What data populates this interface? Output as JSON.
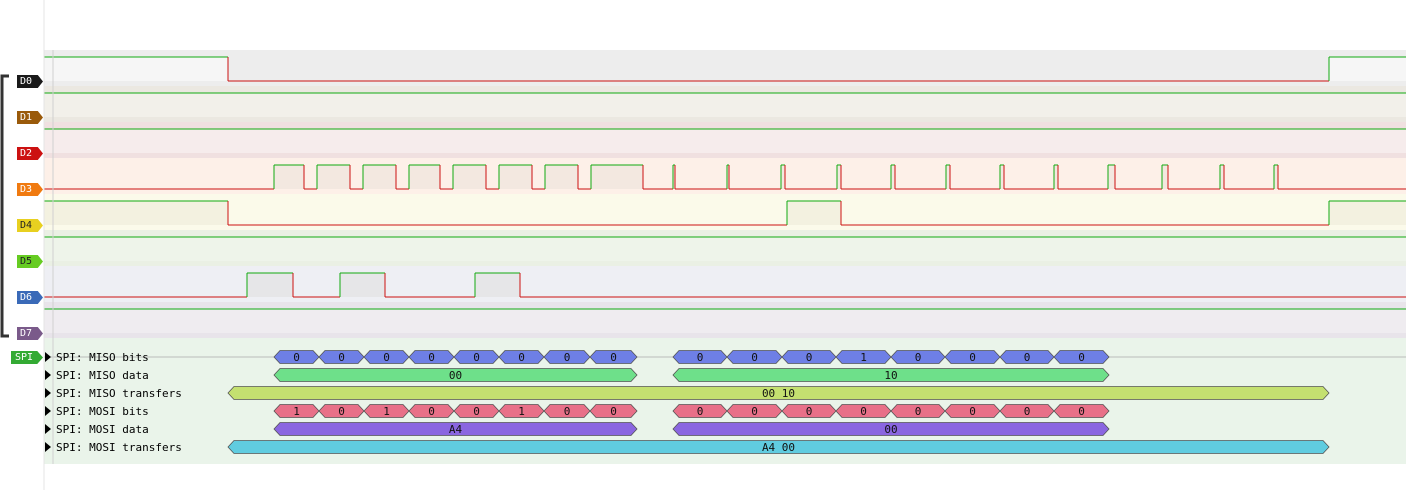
{
  "channels": [
    {
      "name": "D0",
      "color": "#1a1a1a"
    },
    {
      "name": "D1",
      "color": "#9a5a0a"
    },
    {
      "name": "D2",
      "color": "#cc1111"
    },
    {
      "name": "D3",
      "color": "#f07a10"
    },
    {
      "name": "D4",
      "color": "#e8d020"
    },
    {
      "name": "D5",
      "color": "#66cc22"
    },
    {
      "name": "D6",
      "color": "#3a6ab8"
    },
    {
      "name": "D7",
      "color": "#7a5a8a"
    }
  ],
  "decoder": {
    "name": "SPI",
    "color": "#33aa33",
    "rows": [
      {
        "label": "SPI: MISO bits",
        "color": "#6e7fe6",
        "annotations": [
          "0",
          "0",
          "0",
          "0",
          "0",
          "0",
          "0",
          "0",
          "0",
          "0",
          "0",
          "1",
          "0",
          "0",
          "0",
          "0"
        ]
      },
      {
        "label": "SPI: MISO data",
        "color": "#6ee08a",
        "annotations": [
          "00",
          "10"
        ]
      },
      {
        "label": "SPI: MISO transfers",
        "color": "#c4e070",
        "annotations": [
          "00 10"
        ]
      },
      {
        "label": "SPI: MOSI bits",
        "color": "#e87088",
        "annotations": [
          "1",
          "0",
          "1",
          "0",
          "0",
          "1",
          "0",
          "0",
          "0",
          "0",
          "0",
          "0",
          "0",
          "0",
          "0",
          "0"
        ]
      },
      {
        "label": "SPI: MOSI data",
        "color": "#8a66e0",
        "annotations": [
          "A4",
          "00"
        ]
      },
      {
        "label": "SPI: MOSI transfers",
        "color": "#60cce0",
        "annotations": [
          "A4 00"
        ]
      }
    ]
  }
}
